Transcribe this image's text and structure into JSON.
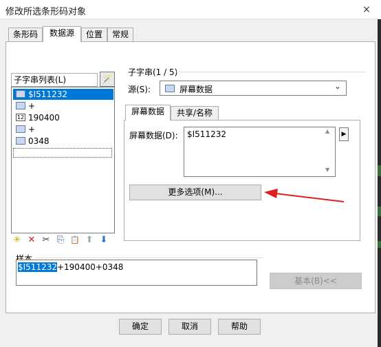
{
  "window": {
    "title": "修改所选条形码对象",
    "close_icon": "×"
  },
  "tabs": [
    "条形码",
    "数据源",
    "位置",
    "常规"
  ],
  "substring_list": {
    "label": "子字串列表(L)",
    "wand_icon": "🪄",
    "items": [
      {
        "label": "$I511232",
        "icon": "screen-data-icon"
      },
      {
        "label": "+",
        "icon": "screen-data-icon"
      },
      {
        "label": "190400",
        "icon": "calendar-icon",
        "icon_text": "12"
      },
      {
        "label": "+",
        "icon": "screen-data-icon"
      },
      {
        "label": "0348",
        "icon": "screen-data-icon"
      }
    ],
    "toolbar_glyphs": [
      "✳",
      "✕",
      "✂",
      "⎘",
      "📋",
      "⬆",
      "⬇"
    ]
  },
  "substring": {
    "title": "子字串(1 / 5)",
    "source_label": "源(S):",
    "source_value": "屏幕数据",
    "inner_tabs": [
      "屏幕数据",
      "共享/名称"
    ],
    "screen_data_label": "屏幕数据(D):",
    "screen_data_value": "$I511232",
    "more_options": "更多选项(M)...",
    "chevron": "⌄",
    "arrow": "▶",
    "scroll_up": "▲",
    "scroll_down": "▼"
  },
  "sample": {
    "label": "样本",
    "highlight": "$I511232",
    "rest": "+190400+0348"
  },
  "basic_button": "基本(B)<<",
  "buttons": {
    "ok": "确定",
    "cancel": "取消",
    "help": "帮助"
  },
  "colors": {
    "accent": "#0078d7",
    "annotation_arrow": "#e02020"
  }
}
